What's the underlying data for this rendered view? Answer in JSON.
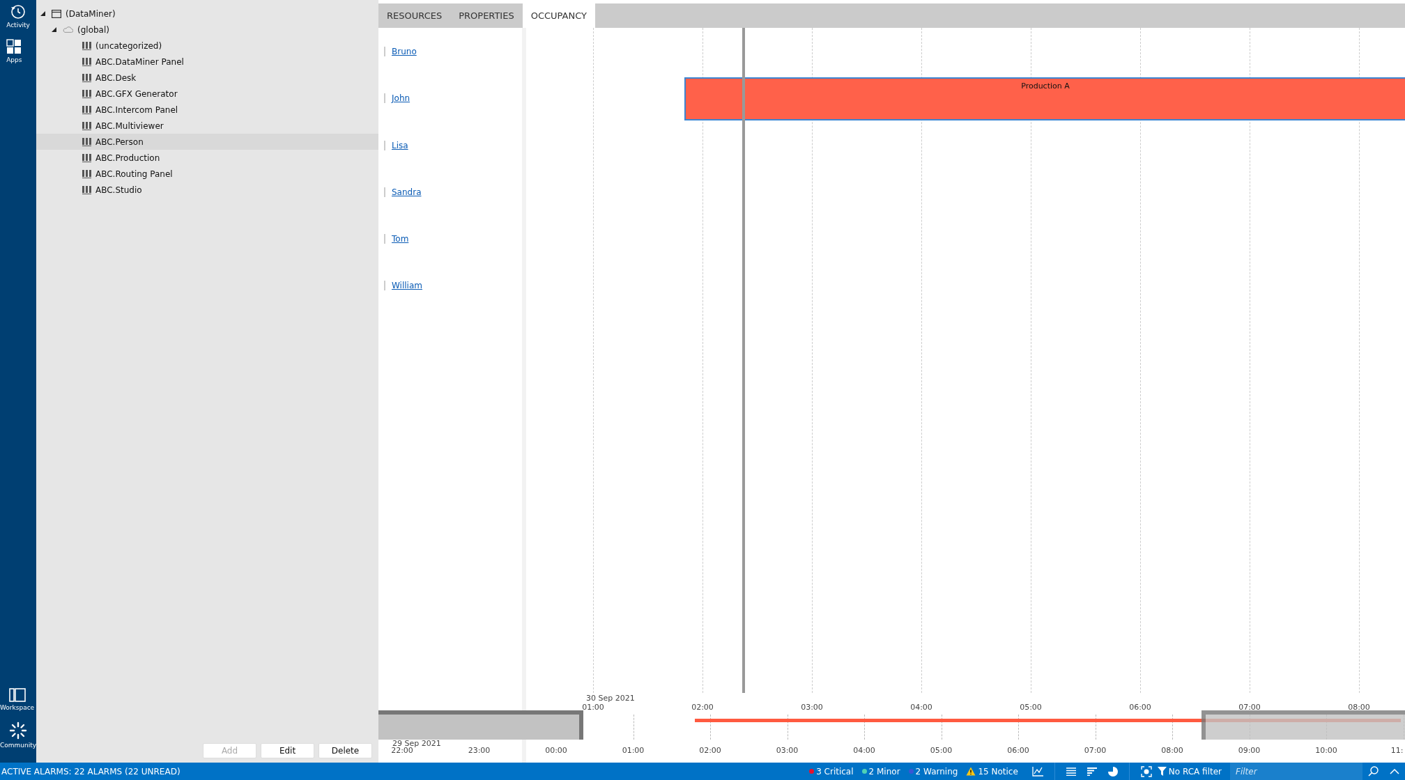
{
  "nav_rail": {
    "top_items": [
      {
        "label": "Activity",
        "kind": "history"
      },
      {
        "label": "Apps",
        "kind": "apps"
      }
    ],
    "bottom_items": [
      {
        "label": "Workspace",
        "kind": "workspace"
      },
      {
        "label": "Community",
        "kind": "community"
      }
    ]
  },
  "tree": [
    {
      "label": "(DataMiner)",
      "kind": "system",
      "expanded": true,
      "children": [
        {
          "label": "(global)",
          "kind": "cloud",
          "expanded": true,
          "children": [
            {
              "label": "(uncategorized)",
              "kind": "pool",
              "selected": false
            },
            {
              "label": "ABC.DataMiner Panel",
              "kind": "pool",
              "selected": false
            },
            {
              "label": "ABC.Desk",
              "kind": "pool",
              "selected": false
            },
            {
              "label": "ABC.GFX Generator",
              "kind": "pool",
              "selected": false
            },
            {
              "label": "ABC.Intercom Panel",
              "kind": "pool",
              "selected": false
            },
            {
              "label": "ABC.Multiviewer",
              "kind": "pool",
              "selected": false
            },
            {
              "label": "ABC.Person",
              "kind": "pool",
              "selected": true
            },
            {
              "label": "ABC.Production",
              "kind": "pool",
              "selected": false
            },
            {
              "label": "ABC.Routing Panel",
              "kind": "pool",
              "selected": false
            },
            {
              "label": "ABC.Studio",
              "kind": "pool",
              "selected": false
            }
          ]
        }
      ]
    }
  ],
  "buttons": [
    {
      "label": "Add",
      "disabled": true
    },
    {
      "label": "Edit",
      "disabled": false
    },
    {
      "label": "Delete",
      "disabled": false
    }
  ],
  "tabs": [
    {
      "label": "RESOURCES",
      "selected": false
    },
    {
      "label": "PROPERTIES",
      "selected": false
    },
    {
      "label": "OCCUPANCY",
      "selected": true
    }
  ],
  "resources": [
    {
      "name": "Bruno"
    },
    {
      "name": "John",
      "bookings": [
        {
          "label": "Production A"
        }
      ]
    },
    {
      "name": "Lisa"
    },
    {
      "name": "Sandra"
    },
    {
      "name": "Tom"
    },
    {
      "name": "William"
    }
  ],
  "timeline": {
    "date": "30 Sep 2021",
    "ticks": [
      "01:00",
      "02:00",
      "03:00",
      "04:00",
      "05:00",
      "06:00",
      "07:00",
      "08:00"
    ]
  },
  "overview": {
    "date": "29 Sep 2021",
    "ticks": [
      "22:00",
      "23:00",
      "00:00",
      "01:00",
      "02:00",
      "03:00",
      "04:00",
      "05:00",
      "06:00",
      "07:00",
      "08:00",
      "09:00",
      "10:00",
      "11:"
    ]
  },
  "status_bar": {
    "alarms": "ACTIVE ALARMS: 22 ALARMS (22 UNREAD)",
    "counters": [
      {
        "label": "3 Critical",
        "kind": "dot",
        "color": "#e8112d"
      },
      {
        "label": "2 Minor",
        "kind": "dot",
        "color": "#4fd1b5"
      },
      {
        "label": "2 Warning",
        "kind": "dot",
        "color": "#3a56d4"
      },
      {
        "label": "15 Notice",
        "kind": "warning"
      }
    ],
    "rca": "No RCA filter",
    "filter_placeholder": "Filter"
  }
}
